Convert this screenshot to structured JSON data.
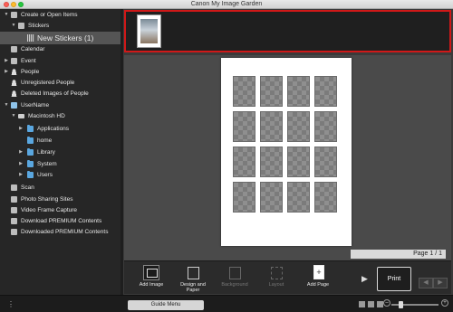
{
  "window": {
    "title": "Canon My Image Garden"
  },
  "sidebar": {
    "items": [
      {
        "label": "Create or Open Items",
        "arrow": "▼",
        "icon": "create-items-icon"
      },
      {
        "label": "Stickers",
        "arrow": "▼",
        "icon": "sticker-icon"
      },
      {
        "label": "New Stickers (1)",
        "arrow": "",
        "icon": "sticker-grid-icon",
        "selected": true
      },
      {
        "label": "Calendar",
        "arrow": "",
        "icon": "calendar-icon"
      },
      {
        "label": "Event",
        "arrow": "▶",
        "icon": "event-icon"
      },
      {
        "label": "People",
        "arrow": "▶",
        "icon": "people-icon"
      },
      {
        "label": "Unregistered People",
        "arrow": "",
        "icon": "person-icon"
      },
      {
        "label": "Deleted Images of People",
        "arrow": "",
        "icon": "person-icon"
      },
      {
        "label": "UserName",
        "arrow": "▼",
        "icon": "computer-icon"
      },
      {
        "label": "Macintosh HD",
        "arrow": "▼",
        "icon": "drive-icon"
      },
      {
        "label": "Applications",
        "arrow": "▶",
        "icon": "folder-icon"
      },
      {
        "label": "home",
        "arrow": "",
        "icon": "folder-icon"
      },
      {
        "label": "Library",
        "arrow": "▶",
        "icon": "folder-icon"
      },
      {
        "label": "System",
        "arrow": "▶",
        "icon": "folder-icon"
      },
      {
        "label": "Users",
        "arrow": "▶",
        "icon": "folder-icon"
      },
      {
        "label": "Scan",
        "arrow": "",
        "icon": "scan-icon"
      },
      {
        "label": "Photo Sharing Sites",
        "arrow": "",
        "icon": "photo-sharing-icon"
      },
      {
        "label": "Video Frame Capture",
        "arrow": "",
        "icon": "video-icon"
      },
      {
        "label": "Download PREMIUM Contents",
        "arrow": "",
        "icon": "download-icon"
      },
      {
        "label": "Downloaded PREMIUM Contents",
        "arrow": "",
        "icon": "downloaded-icon"
      }
    ]
  },
  "canvas": {
    "page_indicator": "Page 1 / 1"
  },
  "toolbar": {
    "add_image": "Add Image",
    "design_and_paper": "Design and Paper",
    "background": "Background",
    "layout": "Layout",
    "add_page": "Add Page",
    "print": "Print",
    "prev": "◀",
    "next": "▶"
  },
  "statusbar": {
    "guide_menu": "Guide Menu"
  },
  "colors": {
    "selection_border": "#d01818",
    "folder": "#5aa7e0",
    "sidebar_bg": "#262626"
  }
}
